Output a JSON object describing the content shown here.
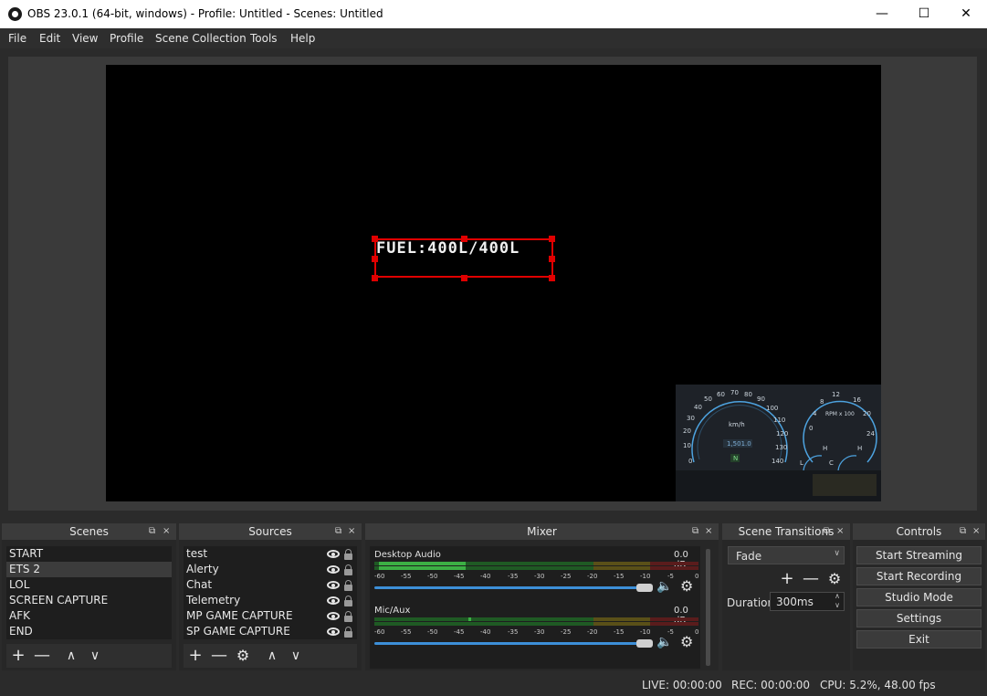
{
  "window": {
    "title": "OBS 23.0.1 (64-bit, windows) - Profile: Untitled - Scenes: Untitled",
    "minimize": "—",
    "maximize": "☐",
    "close": "✕"
  },
  "menu": [
    "File",
    "Edit",
    "View",
    "Profile",
    "Scene Collection",
    "Tools",
    "Help"
  ],
  "preview": {
    "selected_text": "FUEL:400L/400L"
  },
  "telemetry": {
    "speed_ticks": [
      "0",
      "10",
      "20",
      "30",
      "40",
      "50",
      "60",
      "70",
      "80",
      "90",
      "100",
      "110",
      "120",
      "130",
      "140"
    ],
    "speed_unit": "km/h",
    "odometer": "1,501.0",
    "gear": "N",
    "rpm_ticks": [
      "0",
      "4",
      "8",
      "12",
      "16",
      "20",
      "24"
    ],
    "rpm_unit": "RPM x 100",
    "fuel_min": "L",
    "fuel_max": "H",
    "temp_min": "C",
    "temp_max": "H"
  },
  "scenes": {
    "title": "Scenes",
    "items": [
      "START",
      "ETS 2",
      "LOL",
      "SCREEN CAPTURE",
      "AFK",
      "END"
    ],
    "selected_index": 1
  },
  "sources": {
    "title": "Sources",
    "items": [
      "test",
      "Alerty",
      "Chat",
      "Telemetry",
      "MP GAME CAPTURE",
      "SP GAME CAPTURE"
    ]
  },
  "mixer": {
    "title": "Mixer",
    "channels": [
      {
        "name": "Desktop Audio",
        "level": "0.0 dB",
        "volume_fraction": 1.0
      },
      {
        "name": "Mic/Aux",
        "level": "0.0 dB",
        "volume_fraction": 1.0
      }
    ],
    "scale": [
      "-60",
      "-55",
      "-50",
      "-45",
      "-40",
      "-35",
      "-30",
      "-25",
      "-20",
      "-15",
      "-10",
      "-5",
      "0"
    ]
  },
  "transitions": {
    "title": "Scene Transitions",
    "selected": "Fade",
    "duration_label": "Duration",
    "duration_value": "300ms"
  },
  "controls": {
    "title": "Controls",
    "buttons": [
      "Start Streaming",
      "Start Recording",
      "Studio Mode",
      "Settings",
      "Exit"
    ]
  },
  "status": {
    "live": "LIVE: 00:00:00",
    "rec": "REC: 00:00:00",
    "cpu": "CPU: 5.2%, 48.00 fps"
  },
  "icons": {
    "add": "+",
    "remove": "—",
    "up": "∧",
    "down": "∨",
    "gear": "⚙",
    "speaker": "🔈",
    "float": "⧉",
    "close": "×"
  },
  "colors": {
    "accent_blue": "#3d8fd8",
    "selection_red": "#e00000",
    "meter_green": "#3cb044",
    "meter_yellow": "#a89a2c",
    "meter_red": "#9a2a2a"
  }
}
